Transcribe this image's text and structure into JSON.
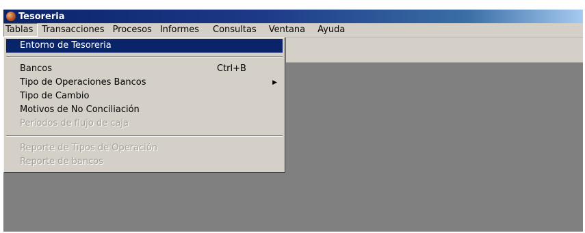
{
  "window": {
    "title": "Tesoreria"
  },
  "menubar": {
    "items": [
      "Tablas",
      "Transacciones",
      "Procesos",
      "Informes",
      "Consultas",
      "Ventana",
      "Ayuda"
    ]
  },
  "dropdown": {
    "entorno": "Entorno de Tesoreria",
    "bancos": "Bancos",
    "bancos_shortcut": "Ctrl+B",
    "tipo_operaciones": "Tipo de Operaciones Bancos",
    "tipo_cambio": "Tipo de Cambio",
    "motivos": "Motivos de No Conciliación",
    "periodos": "Periodos de flujo de caja",
    "reporte_tipos": "Reporte de Tipos de Operación",
    "reporte_bancos": "Reporte de bancos"
  },
  "colors": {
    "title_bar": "#0a246a",
    "highlight": "#0a246a",
    "menu_bg": "#d4d0c8",
    "workspace": "#808080",
    "disabled_text": "#a3a097"
  }
}
